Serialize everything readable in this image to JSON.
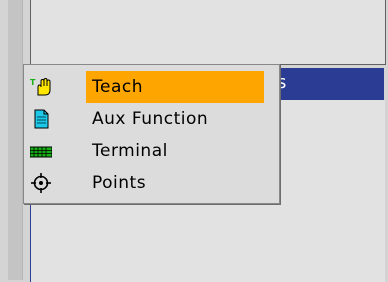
{
  "header": {
    "partial_text": "s"
  },
  "menu": {
    "items": [
      {
        "label": "Teach",
        "icon": "hand-icon",
        "selected": true
      },
      {
        "label": "Aux Function",
        "icon": "document-icon",
        "selected": false
      },
      {
        "label": "Terminal",
        "icon": "keyboard-icon",
        "selected": false
      },
      {
        "label": "Points",
        "icon": "crosshair-icon",
        "selected": false
      }
    ]
  },
  "colors": {
    "selection": "#ffa500",
    "header_bar": "#2a3c94",
    "document_icon": "#1ec8e8",
    "keyboard_icon": "#16b016",
    "teach_marker": "#18b018"
  }
}
